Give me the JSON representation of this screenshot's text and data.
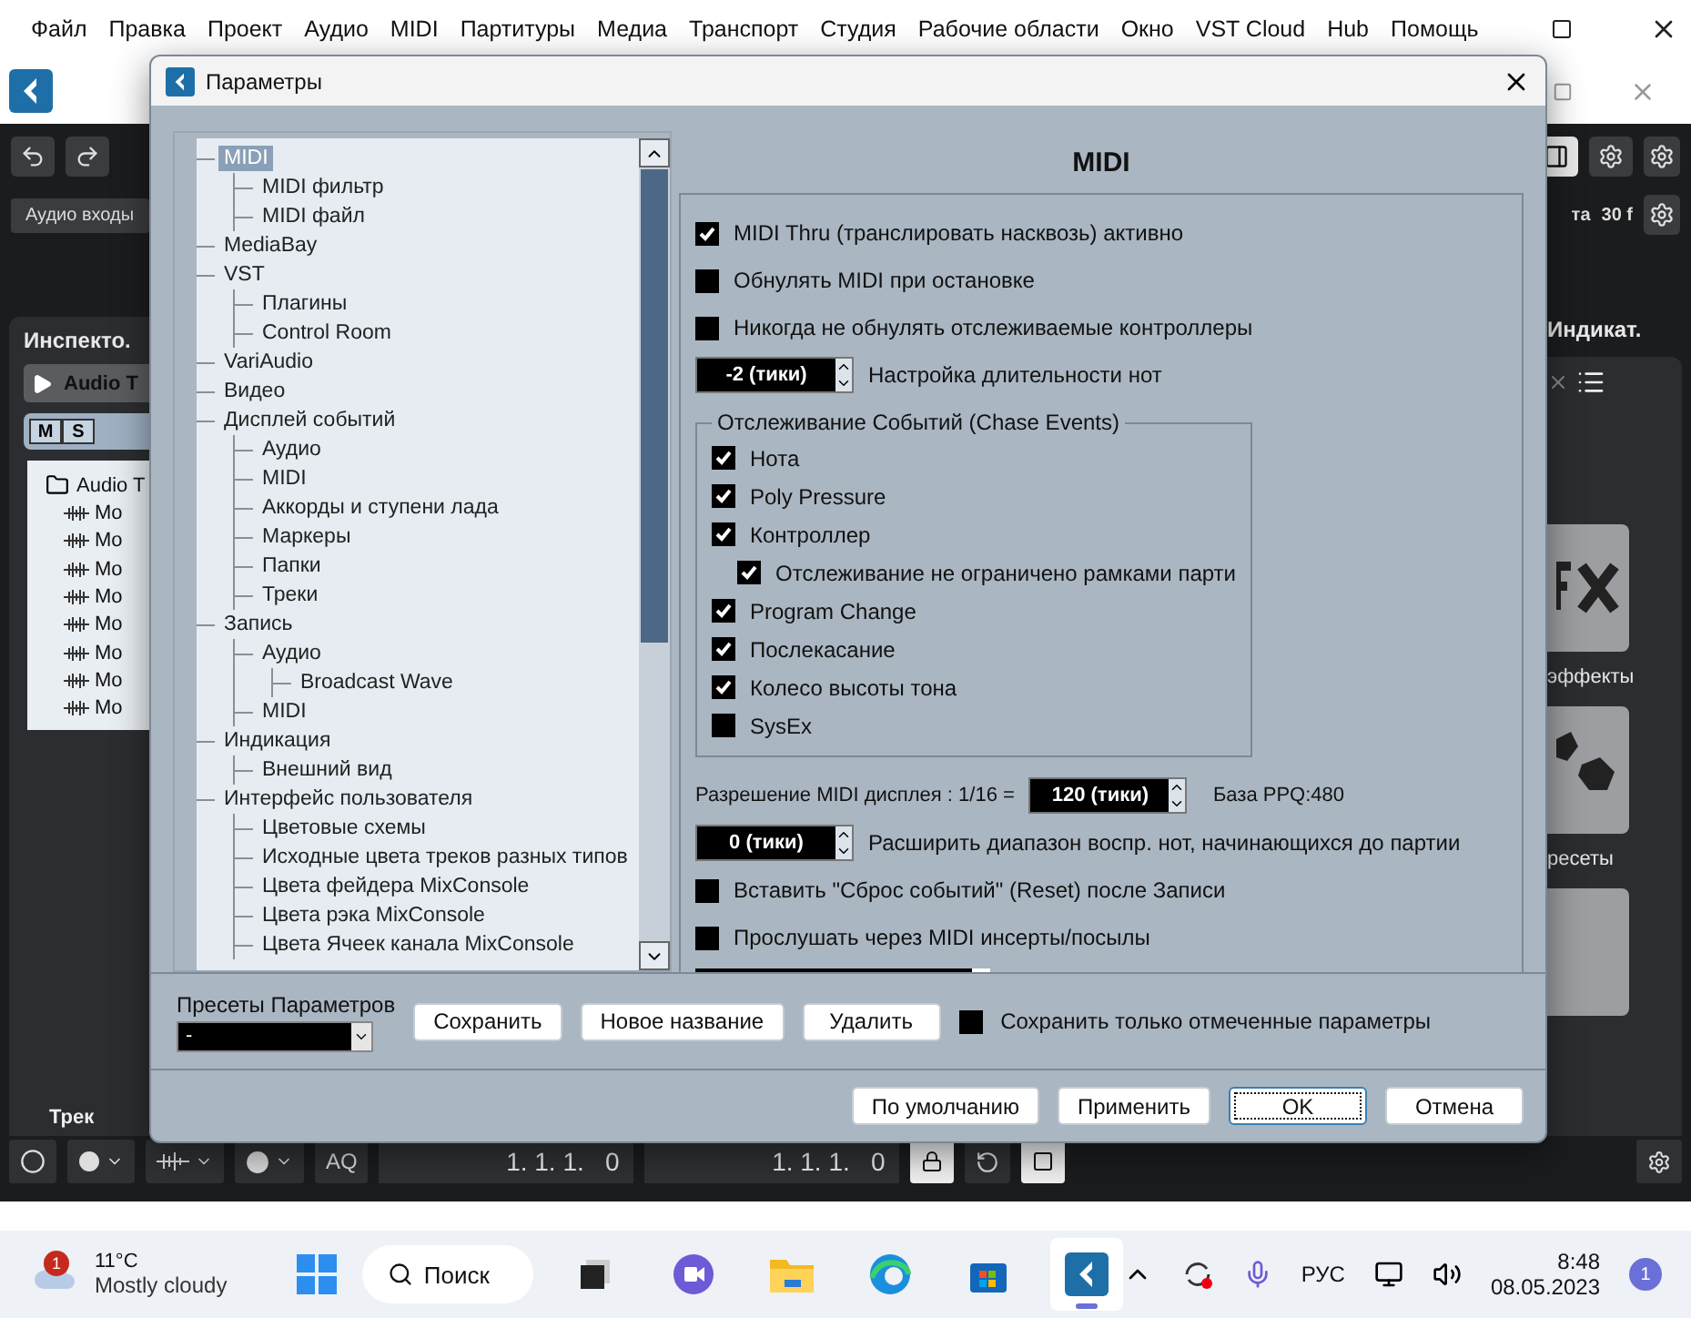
{
  "menu_bar": {
    "items": [
      "Файл",
      "Правка",
      "Проект",
      "Аудио",
      "MIDI",
      "Партитуры",
      "Медиа",
      "Транспорт",
      "Студия",
      "Рабочие области",
      "Окно",
      "VST Cloud",
      "Hub",
      "Помощь"
    ]
  },
  "app": {
    "toolbar": {
      "inputs_label": "Аудио входы",
      "rate_label": "та",
      "rate_value": "30 f"
    },
    "inspector": {
      "title": "Инспекто.",
      "track_name": "Audio T",
      "mute": "M",
      "solo": "S",
      "folder": "Audio T",
      "tracks": [
        "Mo",
        "Mo",
        "Mo",
        "Mo",
        "Mo",
        "Mo",
        "Mo",
        "Mo"
      ],
      "tab": "Трек"
    },
    "right_zone": {
      "title": "Индикат.",
      "tiles": [
        {
          "kind": "fx",
          "label": "эффекты"
        },
        {
          "kind": "presets",
          "label": "ресеты"
        },
        {
          "kind": "other"
        }
      ]
    },
    "transport": {
      "aq": "AQ",
      "left_locator": "1. 1. 1.   0",
      "right_locator": "1. 1. 1.   0"
    }
  },
  "dialog": {
    "title": "Параметры",
    "tree": [
      {
        "label": "MIDI",
        "selected": true,
        "children": [
          {
            "label": "MIDI фильтр",
            "selected": false
          },
          {
            "label": "MIDI файл",
            "selected": false
          }
        ]
      },
      {
        "label": "MediaBay",
        "selected": false
      },
      {
        "label": "VST",
        "selected": false,
        "children": [
          {
            "label": "Плагины",
            "selected": false
          },
          {
            "label": "Control Room",
            "selected": false
          }
        ]
      },
      {
        "label": "VariAudio",
        "selected": false
      },
      {
        "label": "Видео",
        "selected": false
      },
      {
        "label": "Дисплей событий",
        "selected": false,
        "children": [
          {
            "label": "Аудио",
            "selected": false
          },
          {
            "label": "MIDI",
            "selected": false
          },
          {
            "label": "Аккорды и ступени лада",
            "selected": false
          },
          {
            "label": "Маркеры",
            "selected": false
          },
          {
            "label": "Папки",
            "selected": false
          },
          {
            "label": "Треки",
            "selected": false
          }
        ]
      },
      {
        "label": "Запись",
        "selected": false,
        "children": [
          {
            "label": "Аудио",
            "selected": false,
            "children": [
              {
                "label": "Broadcast Wave",
                "selected": false
              }
            ]
          },
          {
            "label": "MIDI",
            "selected": false
          }
        ]
      },
      {
        "label": "Индикация",
        "selected": false,
        "children": [
          {
            "label": "Внешний вид",
            "selected": false
          }
        ]
      },
      {
        "label": "Интерфейс пользователя",
        "selected": false,
        "children": [
          {
            "label": "Цветовые схемы",
            "selected": false
          },
          {
            "label": "Исходные цвета треков разных типов",
            "selected": false
          },
          {
            "label": "Цвета фейдера MixConsole",
            "selected": false
          },
          {
            "label": "Цвета рэка MixConsole",
            "selected": false
          },
          {
            "label": "Цвета Ячеек канала MixConsole",
            "selected": false
          }
        ]
      }
    ],
    "page_title": "MIDI",
    "settings": [
      {
        "kind": "checkbox",
        "label": "MIDI Thru (транслировать насквозь) активно",
        "checked": true
      },
      {
        "kind": "checkbox",
        "label": "Обнулять MIDI при остановке",
        "checked": false
      },
      {
        "kind": "checkbox",
        "label": "Никогда не обнулять отслеживаемые контроллеры",
        "checked": false
      },
      {
        "kind": "spinner",
        "value": "-2 (тики)",
        "caption": "Настройка длительности нот"
      },
      {
        "kind": "group",
        "title": "Отслеживание Событий (Chase Events)",
        "items": [
          {
            "label": "Нота",
            "checked": true
          },
          {
            "label": "Poly Pressure",
            "checked": true
          },
          {
            "label": "Контроллер",
            "checked": true,
            "children": [
              {
                "label": "Отслеживание не ограничено рамками парти",
                "checked": true
              }
            ]
          },
          {
            "label": "Program Change",
            "checked": true
          },
          {
            "label": "Послекасание",
            "checked": true
          },
          {
            "label": "Колесо высоты тона",
            "checked": true
          },
          {
            "label": "SysEx",
            "checked": false
          }
        ]
      },
      {
        "kind": "resolution",
        "label": "Разрешение MIDI дисплея : 1/16 =",
        "value": "120 (тики)",
        "note": "База PPQ:480"
      },
      {
        "kind": "spinner",
        "value": "0 (тики)",
        "caption": "Расширить диапазон воспр. нот, начинающихся до партии"
      },
      {
        "kind": "checkbox",
        "label": "Вставить \"Сброс событий\" (Reset) после Записи",
        "checked": false
      },
      {
        "kind": "checkbox",
        "label": "Прослушать через MIDI инсерты/посылы",
        "checked": false
      },
      {
        "kind": "cut"
      }
    ],
    "presets": {
      "label": "Пресеты Параметров",
      "value": "-",
      "buttons": [
        "Сохранить",
        "Новое название",
        "Удалить"
      ],
      "only_marked": {
        "label": "Сохранить только отмеченные параметры",
        "checked": false
      }
    },
    "buttons": [
      {
        "label": "По умолчанию",
        "focused": false
      },
      {
        "label": "Применить",
        "focused": false
      },
      {
        "label": "OK",
        "focused": true
      },
      {
        "label": "Отмена",
        "focused": false
      }
    ]
  },
  "taskbar": {
    "weather": {
      "badge": "1",
      "temp": "11°C",
      "desc": "Mostly cloudy"
    },
    "search": "Поиск",
    "apps": [
      {
        "kind": "taskview",
        "active": false
      },
      {
        "kind": "chat",
        "active": false
      },
      {
        "kind": "files",
        "active": false
      },
      {
        "kind": "browser",
        "active": false
      },
      {
        "kind": "store",
        "active": false
      },
      {
        "kind": "cubase",
        "active": true
      }
    ],
    "lang": "РУС",
    "time": "8:48",
    "date": "08.05.2023",
    "notifications": "1"
  }
}
